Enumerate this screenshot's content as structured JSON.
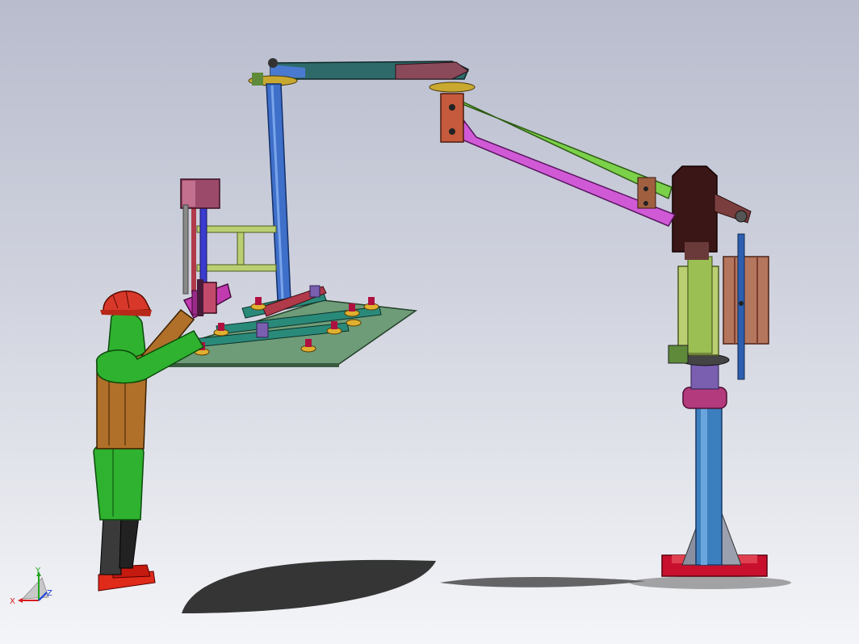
{
  "viewport": {
    "background_top": "#b8bccd",
    "background_bottom": "#f4f5f8"
  },
  "model": {
    "components": [
      "operator-figure",
      "vacuum-lifter-plate",
      "suction-cups",
      "handle-bar",
      "control-box",
      "vertical-mast",
      "top-arm",
      "parallel-link-arms",
      "column-head",
      "pneumatic-cylinder",
      "column-post",
      "base-plate"
    ],
    "colors": {
      "helmet": "#d8382a",
      "operator_arms": "#2fb22f",
      "operator_torso": "#b0702a",
      "lifter_plate": "#6e9c78",
      "mast": "#3e6fc9",
      "link_upper": "#7bd14a",
      "link_lower": "#d05ad6",
      "column": "#3b7fbf",
      "base": "#c8102e",
      "cylinder": "#b5765e",
      "head": "#3a1616"
    }
  },
  "triad": {
    "x_label": "X",
    "y_label": "Y",
    "z_label": "Z",
    "x_color": "#d81c1c",
    "y_color": "#1fa51f",
    "z_color": "#1c3ed8"
  }
}
